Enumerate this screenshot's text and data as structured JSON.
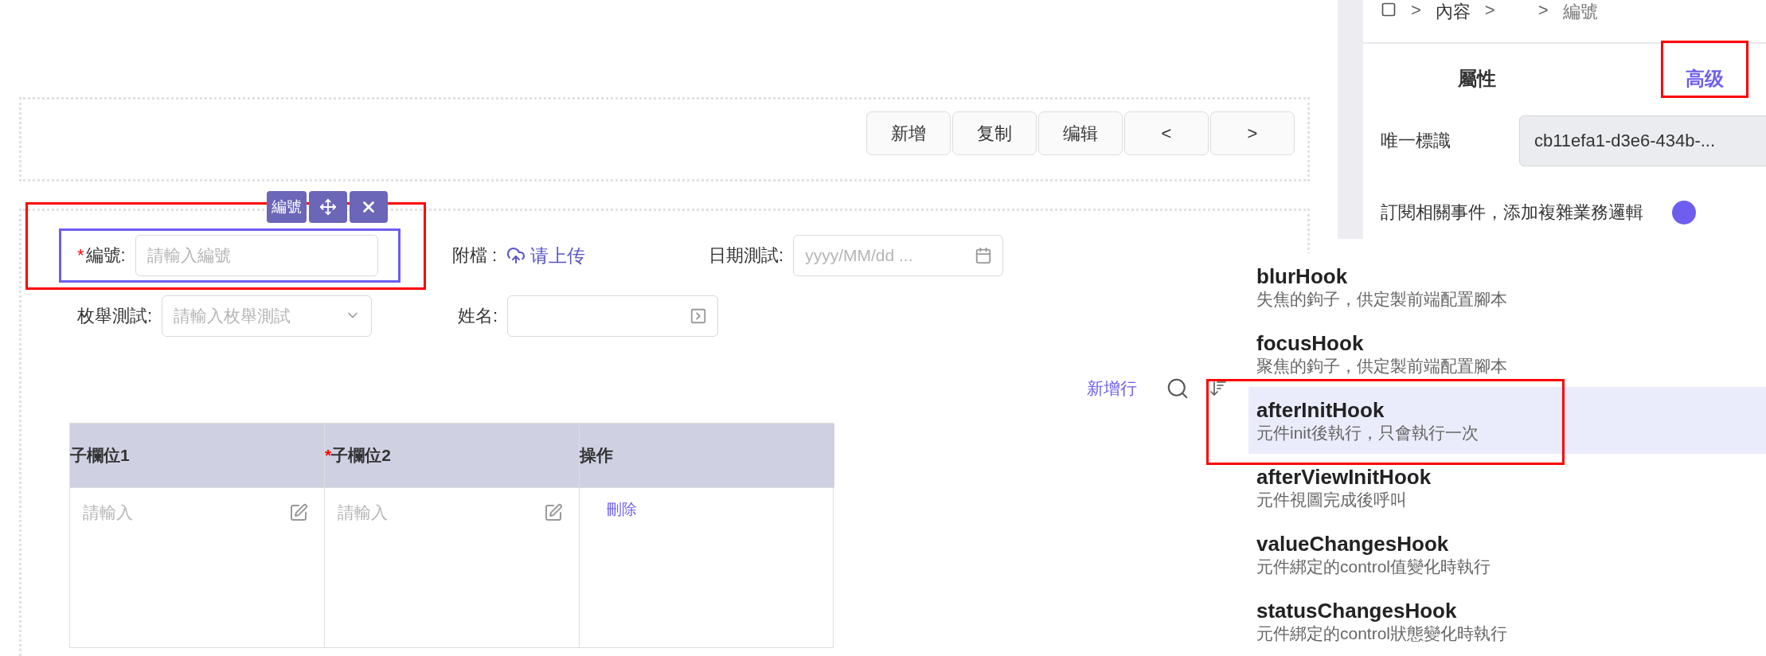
{
  "toolbar": {
    "buttons": [
      "新增",
      "复制",
      "编辑",
      "<",
      ">"
    ]
  },
  "form": {
    "field_tag": "編號",
    "rows": [
      [
        {
          "kind": "text",
          "label": "編號:",
          "required_mark": "*",
          "placeholder": "請輸入編號",
          "selected": true,
          "annotated": true
        },
        {
          "kind": "upload",
          "label": "附檔 :",
          "link": "请上传",
          "selected": false,
          "annotated": false
        },
        {
          "kind": "date",
          "label": "日期測試:",
          "placeholder": "yyyy/MM/dd ...",
          "selected": false,
          "annotated": false
        }
      ],
      [
        {
          "kind": "select",
          "label": "枚舉測試:",
          "placeholder": "請輸入枚舉測試",
          "selected": false,
          "annotated": false
        },
        {
          "kind": "lookup",
          "label": "姓名:",
          "selected": false,
          "annotated": false
        }
      ]
    ]
  },
  "subtable": {
    "add_row": "新增行",
    "columns": [
      {
        "label": "子欄位1"
      },
      {
        "label": "子欄位2",
        "required_mark": "*"
      },
      {
        "label": "操作"
      }
    ],
    "rows": [
      {
        "cells": [
          {
            "placeholder": "請輸入"
          },
          {
            "placeholder": "請輸入"
          }
        ],
        "action": "刪除"
      }
    ]
  },
  "panel": {
    "breadcrumb_separator": ">",
    "breadcrumb": [
      {
        "kind": "home"
      },
      {
        "kind": "text",
        "label": "內容"
      },
      {
        "kind": "blank"
      },
      {
        "kind": "text",
        "label": "編號"
      }
    ],
    "tabs": [
      {
        "label": "屬性",
        "selected": false,
        "annotated": false
      },
      {
        "label": "高级",
        "selected": true,
        "annotated": true
      }
    ],
    "fields": [
      {
        "kind": "input",
        "label": "唯一標識",
        "value": "cb11efa1-d3e6-434b-..."
      },
      {
        "kind": "switch",
        "label": "訂閱相關事件，添加複雜業務邏輯",
        "on": true
      }
    ]
  },
  "hooks": [
    {
      "name": "blurHook",
      "description": "失焦的鉤子，供定製前端配置腳本",
      "selected": false,
      "annotated": false
    },
    {
      "name": "focusHook",
      "description": "聚焦的鉤子，供定製前端配置腳本",
      "selected": false,
      "annotated": false
    },
    {
      "name": "afterInitHook",
      "description": "元件init後執行，只會執行一次",
      "selected": true,
      "annotated": true
    },
    {
      "name": "afterViewInitHook",
      "description": "元件視圖完成後呼叫",
      "selected": false,
      "annotated": false
    },
    {
      "name": "valueChangesHook",
      "description": "元件綁定的control值變化時執行",
      "selected": false,
      "annotated": false
    },
    {
      "name": "statusChangesHook",
      "description": "元件綁定的control狀態變化時執行",
      "selected": false,
      "annotated": false
    }
  ]
}
